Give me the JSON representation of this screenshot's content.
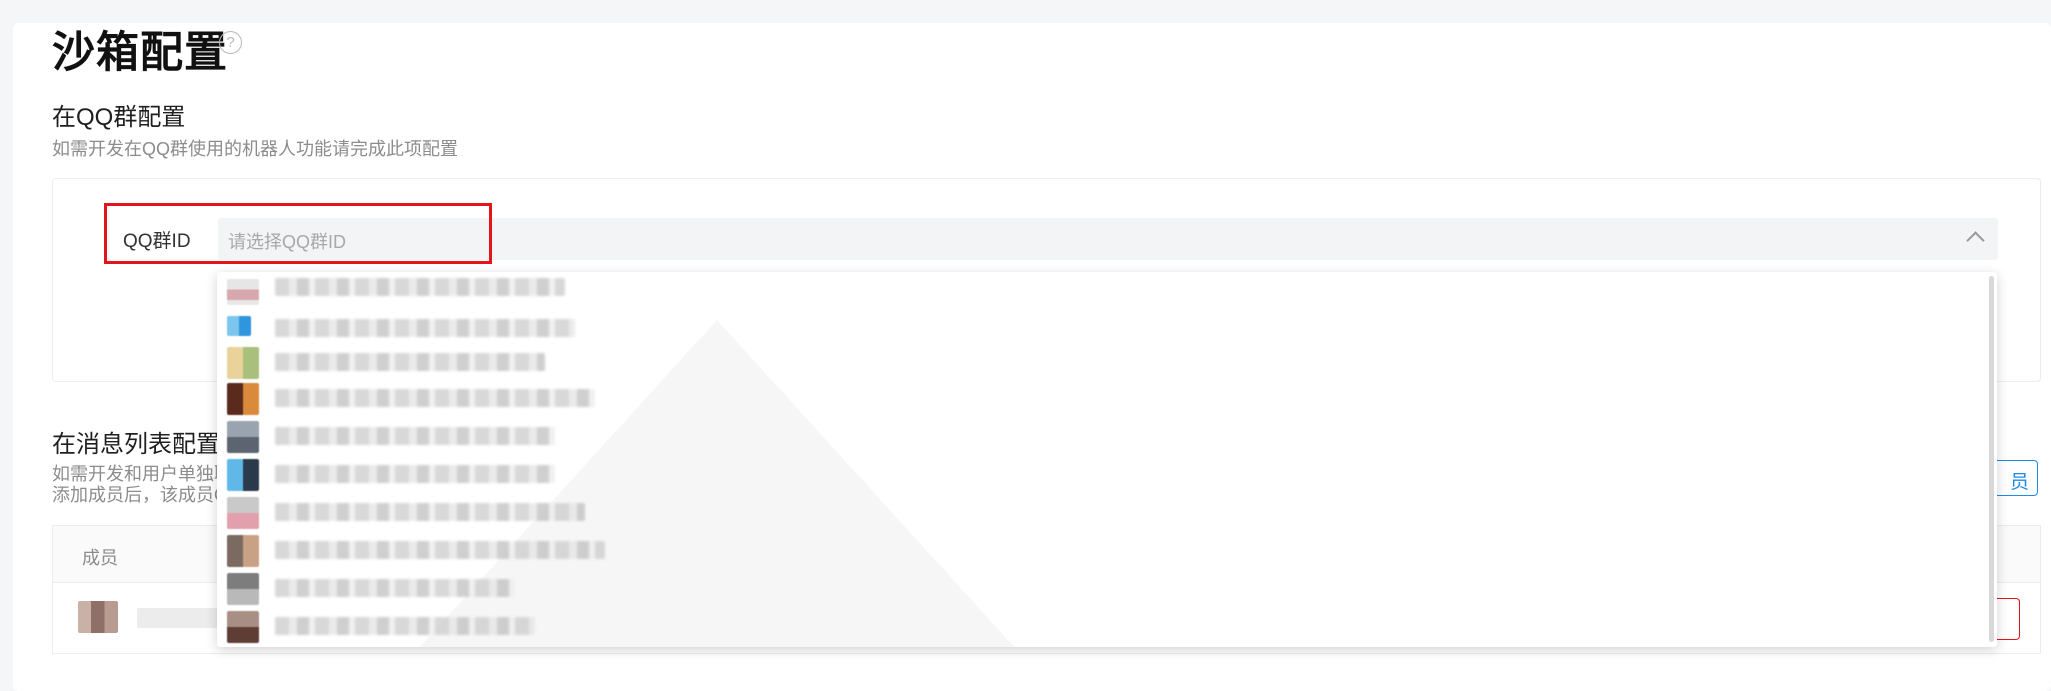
{
  "page": {
    "title": "沙箱配置",
    "help_icon": "question-circle-icon"
  },
  "qq_group": {
    "section_title": "在QQ群配置",
    "description": "如需开发在QQ群使用的机器人功能请完成此项配置",
    "field_label": "QQ群ID",
    "select_placeholder": "请选择QQ群ID",
    "select_icon": "chevron-up-icon",
    "dropdown_options_count_visible": 10
  },
  "message_list": {
    "section_title": "在消息列表配置",
    "description_line1": "如需开发和用户单独聊",
    "description_line2": "添加成员后，该成员Q",
    "add_member_button_label": "员",
    "table": {
      "columns": [
        "成员"
      ]
    }
  },
  "colors": {
    "accent_blue": "#1e8be8",
    "highlight_red": "#e5141b",
    "muted_text": "#8c8c8c"
  }
}
